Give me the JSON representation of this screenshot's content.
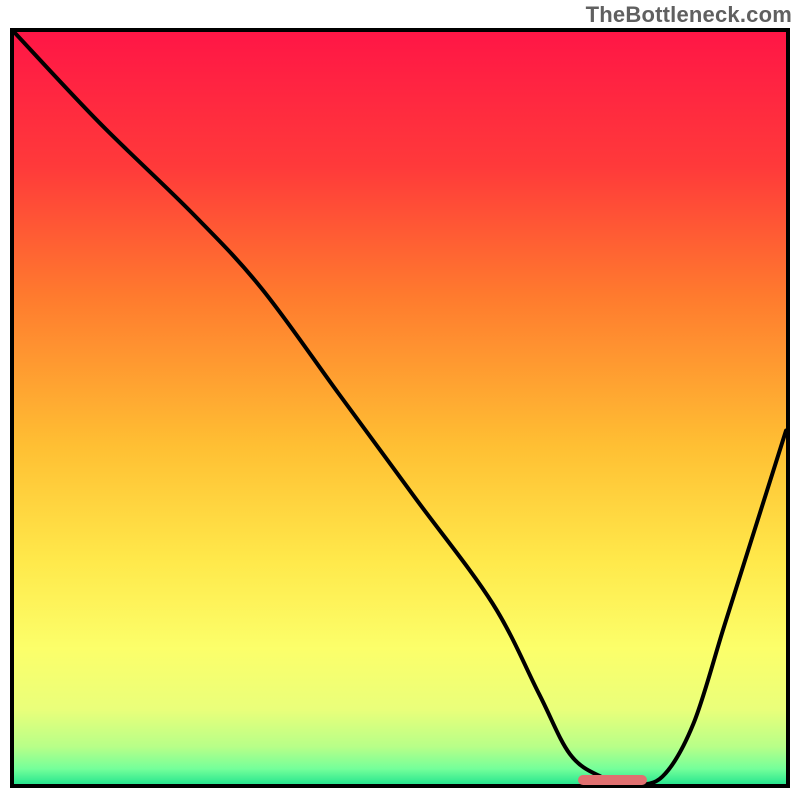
{
  "watermark": {
    "text": "TheBottleneck.com"
  },
  "chart_data": {
    "type": "line",
    "title": "",
    "xlabel": "",
    "ylabel": "",
    "xlim": [
      0,
      100
    ],
    "ylim": [
      0,
      100
    ],
    "gradient_stops": [
      {
        "offset": 0,
        "color": "#ff1646"
      },
      {
        "offset": 18,
        "color": "#ff3a3a"
      },
      {
        "offset": 35,
        "color": "#ff7a2e"
      },
      {
        "offset": 55,
        "color": "#ffbf33"
      },
      {
        "offset": 70,
        "color": "#ffe84a"
      },
      {
        "offset": 82,
        "color": "#fcff6a"
      },
      {
        "offset": 90,
        "color": "#eaff7a"
      },
      {
        "offset": 95,
        "color": "#b8ff88"
      },
      {
        "offset": 98,
        "color": "#74ff9a"
      },
      {
        "offset": 100,
        "color": "#29e68f"
      }
    ],
    "series": [
      {
        "name": "curve",
        "x": [
          0,
          11,
          23,
          32,
          42,
          52,
          62,
          68,
          72,
          76,
          80,
          84,
          88,
          92,
          96,
          100
        ],
        "values": [
          100,
          88,
          76,
          66,
          52,
          38,
          24,
          12,
          4,
          1,
          0,
          1,
          8,
          21,
          34,
          47
        ]
      }
    ],
    "marker": {
      "x_start": 73,
      "x_end": 82,
      "y": 0.5,
      "color": "#e07070"
    }
  }
}
